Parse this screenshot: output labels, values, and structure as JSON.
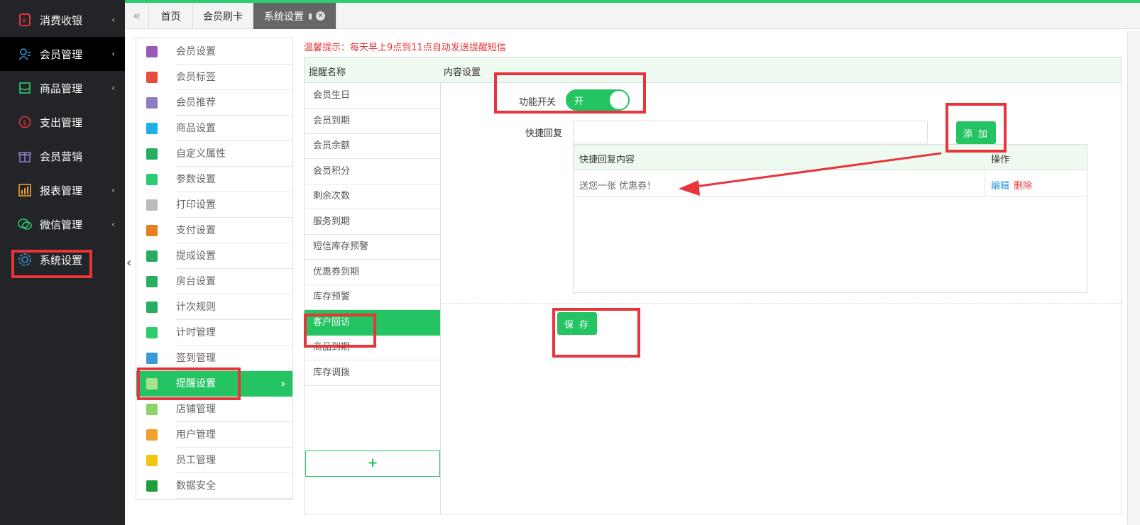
{
  "sidebar": {
    "items": [
      {
        "label": "消费收银",
        "icon": "cashier-icon",
        "has_chevron": true
      },
      {
        "label": "会员管理",
        "icon": "member-icon",
        "has_chevron": true
      },
      {
        "label": "商品管理",
        "icon": "goods-icon",
        "has_chevron": true
      },
      {
        "label": "支出管理",
        "icon": "expense-icon",
        "has_chevron": false
      },
      {
        "label": "会员营销",
        "icon": "gift-icon",
        "has_chevron": false
      },
      {
        "label": "报表管理",
        "icon": "report-icon",
        "has_chevron": true
      },
      {
        "label": "微信管理",
        "icon": "wechat-icon",
        "has_chevron": true
      },
      {
        "label": "系统设置",
        "icon": "gear-icon",
        "has_chevron": false
      }
    ],
    "chevron": "‹"
  },
  "tabs": {
    "prev": "«",
    "items": [
      {
        "label": "首页"
      },
      {
        "label": "会员刷卡"
      },
      {
        "label": "系统设置"
      }
    ],
    "pin": "📌",
    "close": "✕"
  },
  "submenu": {
    "items": [
      {
        "label": "会员设置",
        "color": "#9b59b6"
      },
      {
        "label": "会员标签",
        "color": "#e74c3c"
      },
      {
        "label": "会员推荐",
        "color": "#8e7cc3"
      },
      {
        "label": "商品设置",
        "color": "#1ab0e8"
      },
      {
        "label": "自定义属性",
        "color": "#27ae60"
      },
      {
        "label": "参数设置",
        "color": "#2ecc71"
      },
      {
        "label": "打印设置",
        "color": "#bbbbbb"
      },
      {
        "label": "支付设置",
        "color": "#e67e22"
      },
      {
        "label": "提成设置",
        "color": "#27ae60"
      },
      {
        "label": "房台设置",
        "color": "#27ae60"
      },
      {
        "label": "计次规则",
        "color": "#27ae60"
      },
      {
        "label": "计时管理",
        "color": "#2ecc71"
      },
      {
        "label": "签到管理",
        "color": "#3a9ad9"
      },
      {
        "label": "提醒设置",
        "color": "#8bd36a"
      },
      {
        "label": "店铺管理",
        "color": "#8bd36a"
      },
      {
        "label": "用户管理",
        "color": "#f0a030"
      },
      {
        "label": "员工管理",
        "color": "#f1c40f"
      },
      {
        "label": "数据安全",
        "color": "#1e9e3e"
      }
    ],
    "active_arrow": "›",
    "collapse": "‹"
  },
  "main": {
    "tip": "温馨提示：每天早上9点到11点自动发送提醒短信",
    "header": {
      "col1": "提醒名称",
      "col2": "内容设置"
    },
    "reminders": [
      "会员生日",
      "会员到期",
      "会员余额",
      "会员积分",
      "剩余次数",
      "服务到期",
      "短信库存预警",
      "优惠券到期",
      "库存预警",
      "客户回访",
      "商品到期",
      "库存调拨"
    ],
    "add_reminder": "+",
    "switch_label": "功能开关",
    "switch_value": "开",
    "quick_reply_label": "快捷回复",
    "quick_reply_value": "",
    "add_button": "添 加",
    "table": {
      "col_content": "快捷回复内容",
      "col_action": "操作",
      "rows": [
        {
          "content": "送您一张 优惠券！",
          "edit": "编辑",
          "delete": "删除"
        }
      ]
    },
    "save_button": "保 存"
  },
  "colors": {
    "accent": "#24c462",
    "highlight": "#e8343a",
    "sidebar_bg": "#222428"
  }
}
